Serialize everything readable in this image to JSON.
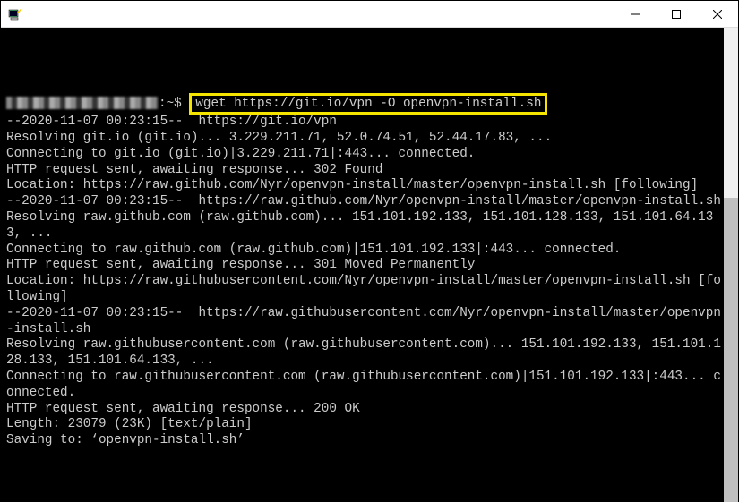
{
  "window": {
    "title": ""
  },
  "prompt": {
    "suffix": ":~$ ",
    "command": "wget https://git.io/vpn -O openvpn-install.sh"
  },
  "output": {
    "lines": [
      "--2020-11-07 00:23:15--  https://git.io/vpn",
      "Resolving git.io (git.io)... 3.229.211.71, 52.0.74.51, 52.44.17.83, ...",
      "Connecting to git.io (git.io)|3.229.211.71|:443... connected.",
      "HTTP request sent, awaiting response... 302 Found",
      "Location: https://raw.github.com/Nyr/openvpn-install/master/openvpn-install.sh [following]",
      "--2020-11-07 00:23:15--  https://raw.github.com/Nyr/openvpn-install/master/openvpn-install.sh",
      "Resolving raw.github.com (raw.github.com)... 151.101.192.133, 151.101.128.133, 151.101.64.133, ...",
      "Connecting to raw.github.com (raw.github.com)|151.101.192.133|:443... connected.",
      "HTTP request sent, awaiting response... 301 Moved Permanently",
      "Location: https://raw.githubusercontent.com/Nyr/openvpn-install/master/openvpn-install.sh [following]",
      "--2020-11-07 00:23:15--  https://raw.githubusercontent.com/Nyr/openvpn-install/master/openvpn-install.sh",
      "Resolving raw.githubusercontent.com (raw.githubusercontent.com)... 151.101.192.133, 151.101.128.133, 151.101.64.133, ...",
      "Connecting to raw.githubusercontent.com (raw.githubusercontent.com)|151.101.192.133|:443... connected.",
      "HTTP request sent, awaiting response... 200 OK",
      "Length: 23079 (23K) [text/plain]",
      "Saving to: ‘openvpn-install.sh’"
    ]
  }
}
